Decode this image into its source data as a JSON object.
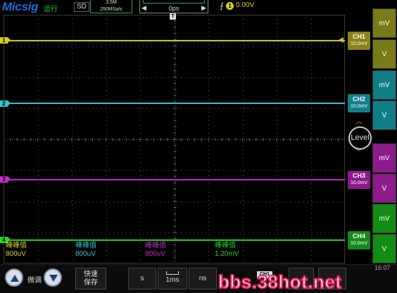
{
  "header": {
    "logo": "Micsig",
    "run_state": "运行",
    "storage": "SD",
    "memory_depth": "3.5M",
    "sample_rate": "250MSa/s",
    "horizontal": {
      "left_arrow": "◀",
      "position": "0ps",
      "right_arrow": "▶"
    },
    "trigger": {
      "edge_icon": "rising-edge-icon",
      "edge_glyph": "⨍",
      "source_number": "1",
      "level": "0.00V"
    }
  },
  "markers": {
    "trigger_position": "T"
  },
  "channels": [
    {
      "id": "1",
      "name": "CH1",
      "scale": "10.0mV",
      "unit_top": "mV",
      "unit_bottom": "V",
      "color": "#d6cf23",
      "label_bg": "#8a8418",
      "unit_bg": "#7a7a18",
      "trace_level": 0.104
    },
    {
      "id": "2",
      "name": "CH2",
      "scale": "10.0mV",
      "unit_top": "mV",
      "unit_bottom": "V",
      "color": "#2ec4d6",
      "label_bg": "#137f8a",
      "unit_bg": "#0f7e86",
      "trace_level": 0.356
    },
    {
      "id": "3",
      "name": "CH3",
      "scale": "10.0mV",
      "unit_top": "mV",
      "unit_bottom": "V",
      "color": "#c92bc9",
      "label_bg": "#8a1b8a",
      "unit_bg": "#8c1b8c",
      "trace_level": 0.663
    },
    {
      "id": "4",
      "name": "CH4",
      "scale": "10.0mV",
      "unit_top": "mV",
      "unit_bottom": "V",
      "color": "#27d627",
      "label_bg": "#168a16",
      "unit_bg": "#138c13",
      "trace_level": 0.906
    }
  ],
  "level_knob": {
    "label": "Level",
    "up": "︿",
    "down": "﹀"
  },
  "measurements": [
    {
      "name": "峰峰值",
      "value": "800uV",
      "color": "#d6cf23"
    },
    {
      "name": "峰峰值",
      "value": "800uV",
      "color": "#2ec4d6"
    },
    {
      "name": "峰峰值",
      "value": "800uV",
      "color": "#c92bc9"
    },
    {
      "name": "峰峰值",
      "value": "1.20mV",
      "color": "#27d627"
    }
  ],
  "bottom": {
    "fine_label": "微调",
    "fast_save_line1": "快速",
    "fast_save_line2": "保存",
    "unit_s": "s",
    "time_value": "1ms",
    "unit_ns": "ns",
    "channel_tab": "CH1",
    "clock": "16:07",
    "watermark": "bbs.38hot.net"
  }
}
